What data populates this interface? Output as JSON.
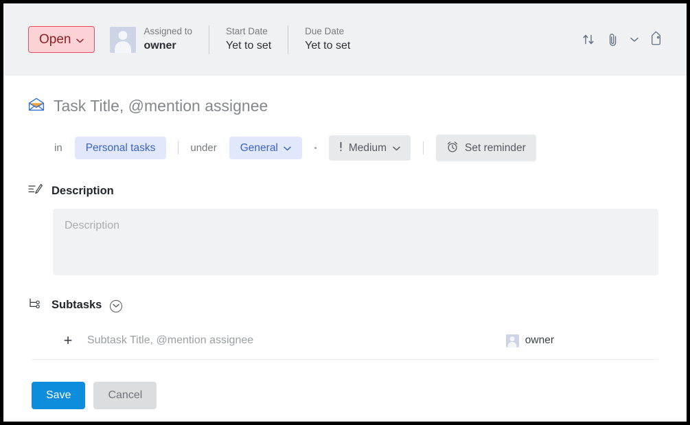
{
  "header": {
    "status": {
      "label": "Open",
      "chevron": "⌄",
      "bg": "#fbd3d4",
      "border": "#e8475f",
      "text": "#8f1f26"
    },
    "assigned": {
      "label": "Assigned to",
      "value": "owner"
    },
    "start_date": {
      "label": "Start Date",
      "value": "Yet to set"
    },
    "due_date": {
      "label": "Due Date",
      "value": "Yet to set"
    },
    "icons": {
      "move": "transfer-icon",
      "attach": "paperclip-icon",
      "attach_chevron": "chevron-down-icon",
      "tag": "tag-icon"
    }
  },
  "task": {
    "title": "Task Title, @mention assignee",
    "title_icon": "open-envelope-icon"
  },
  "attributes": {
    "in_label": "in",
    "project": "Personal tasks",
    "under_label": "under",
    "group": "General",
    "group_chevron": "⌄",
    "priority": "Medium",
    "priority_icon": "exclamation-icon",
    "priority_chevron": "⌄",
    "reminder": "Set reminder",
    "reminder_icon": "alarm-clock-icon"
  },
  "description": {
    "section_title": "Description",
    "section_icon": "lines-pencil-icon",
    "placeholder": "Description",
    "value": ""
  },
  "subtasks": {
    "section_title": "Subtasks",
    "section_icon": "subtask-tree-icon",
    "collapse_icon": "circle-chevron-down-icon",
    "add_icon": "plus-icon",
    "row_placeholder": "Subtask Title, @mention assignee",
    "row_owner": "owner"
  },
  "footer": {
    "save_label": "Save",
    "cancel_label": "Cancel",
    "save_color": "#0e8ddc",
    "cancel_color": "#dcdddf"
  }
}
